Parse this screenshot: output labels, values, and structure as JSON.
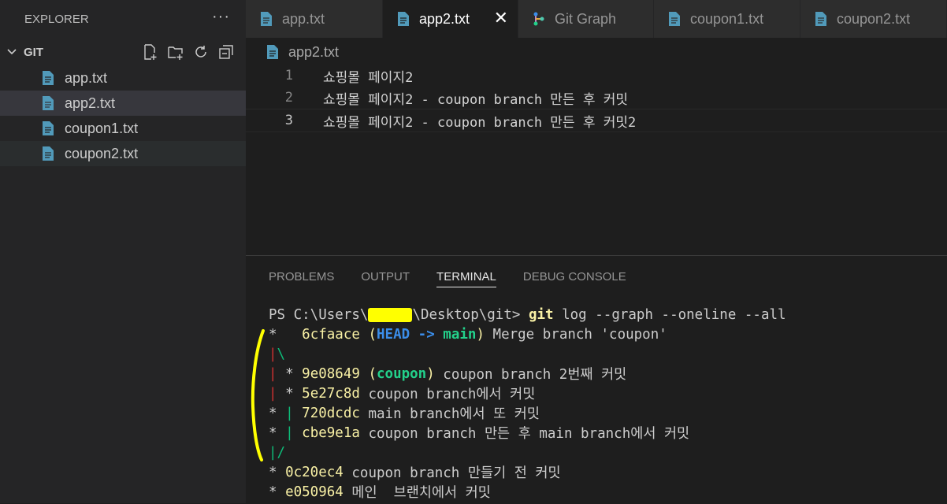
{
  "explorer": {
    "title": "EXPLORER",
    "more": "···",
    "folder": "GIT",
    "files": [
      {
        "label": "app.txt"
      },
      {
        "label": "app2.txt"
      },
      {
        "label": "coupon1.txt"
      },
      {
        "label": "coupon2.txt"
      }
    ]
  },
  "tabs": [
    {
      "label": "app.txt"
    },
    {
      "label": "app2.txt",
      "close": "✕"
    },
    {
      "label": "Git Graph"
    },
    {
      "label": "coupon1.txt"
    },
    {
      "label": "coupon2.txt"
    }
  ],
  "breadcrumb": "app2.txt",
  "editor": {
    "lines": [
      {
        "n": "1",
        "text": "쇼핑몰 페이지2"
      },
      {
        "n": "2",
        "text": "쇼핑몰 페이지2 - coupon branch 만든 후 커밋"
      },
      {
        "n": "3",
        "text": "쇼핑몰 페이지2 - coupon branch 만든 후 커밋2"
      }
    ]
  },
  "panel": {
    "tabs": [
      "PROBLEMS",
      "OUTPUT",
      "TERMINAL",
      "DEBUG CONSOLE"
    ],
    "active": "TERMINAL"
  },
  "terminal": {
    "prompt_a": "PS C:\\Users\\",
    "prompt_b": "\\Desktop\\git> ",
    "cmd": "git",
    "args": " log --graph --oneline --all",
    "l1_graph": "*   ",
    "l1_hash": "6cfaace",
    "l1_open": " (",
    "l1_head": "HEAD -> ",
    "l1_main": "main",
    "l1_close": ")",
    "l1_msg": " Merge branch 'coupon'",
    "l2_a": "|",
    "l2_b": "\\",
    "l3_bar": "|",
    "l3_star": " * ",
    "l3_hash": "9e08649",
    "l3_open": " (",
    "l3_branch": "coupon",
    "l3_close": ")",
    "l3_msg": " coupon branch 2번째 커밋",
    "l4_bar": "|",
    "l4_star": " * ",
    "l4_hash": "5e27c8d",
    "l4_msg": " coupon branch에서 커밋",
    "l5_star": "* ",
    "l5_bar": "|",
    "l5_hash": " 720dcdc",
    "l5_msg": " main branch에서 또 커밋",
    "l6_star": "* ",
    "l6_bar": "|",
    "l6_hash": " cbe9e1a",
    "l6_msg": " coupon branch 만든 후 main branch에서 커밋",
    "l7": "|/",
    "l8_star": "* ",
    "l8_hash": "0c20ec4",
    "l8_msg": " coupon branch 만들기 전 커밋",
    "l9_star": "* ",
    "l9_hash": "e050964",
    "l9_msg": " 메인  브랜치에서 커밋"
  },
  "colors": {
    "file_icon": "#519aba",
    "git_graph_icon": "#c586c0",
    "highlighter": "#ffff00"
  }
}
